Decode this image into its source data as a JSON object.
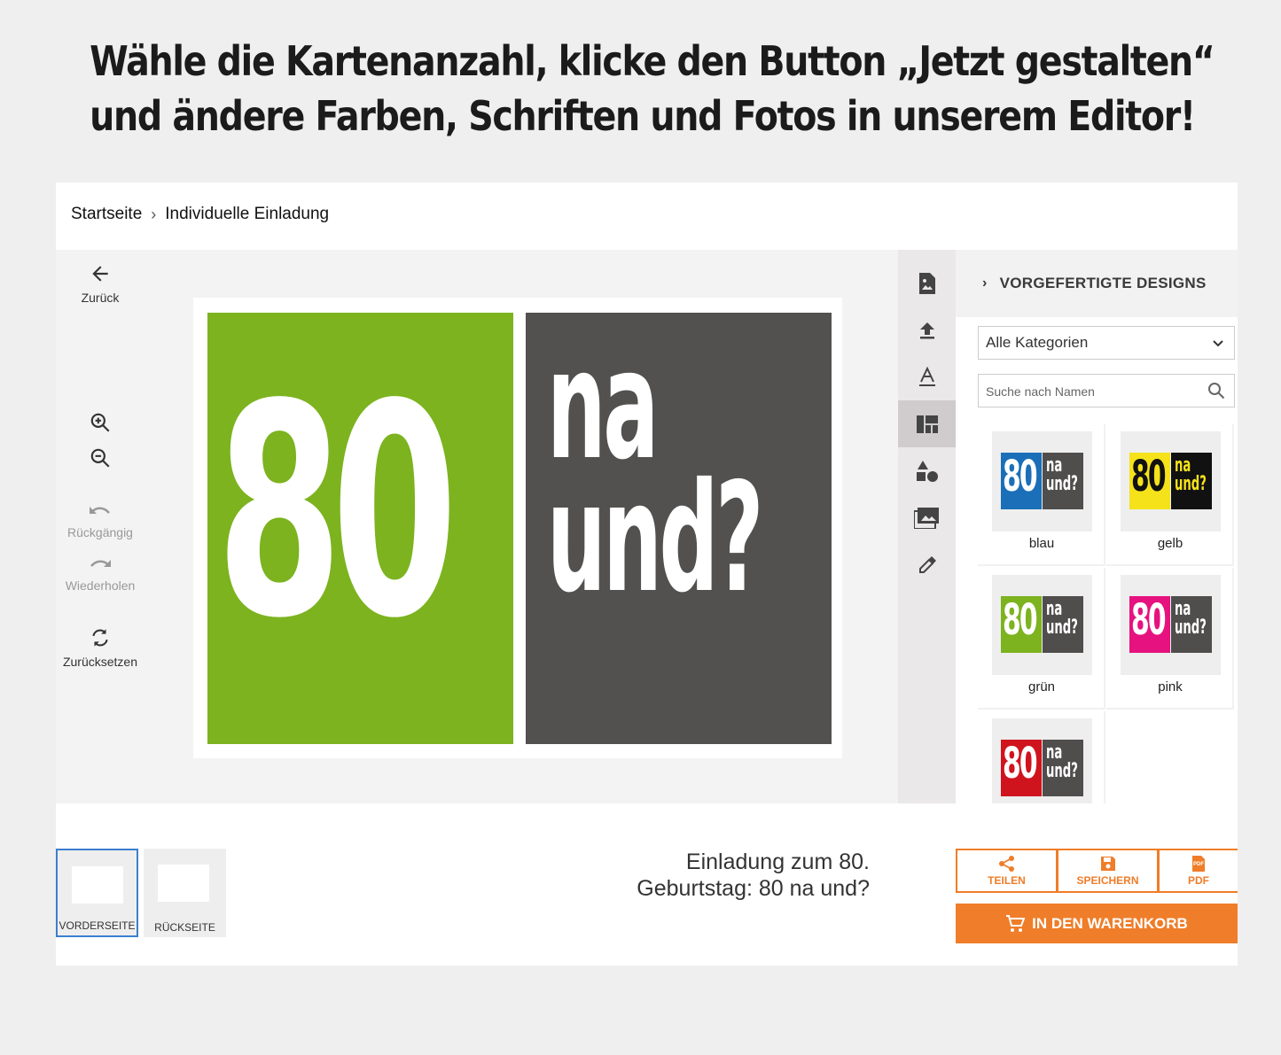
{
  "headline": {
    "line1": "Wähle die Kartenanzahl, klicke den Button „Jetzt gestalten“",
    "line2": "und ändere Farben, Schriften und Fotos in unserem Editor!"
  },
  "breadcrumb": {
    "home": "Startseite",
    "current": "Individuelle Einladung"
  },
  "toolbar": {
    "back": "Zurück",
    "undo": "Rückgängig",
    "redo": "Wiederholen",
    "reset": "Zurücksetzen"
  },
  "card": {
    "number": "80",
    "line1": "na",
    "line2": "und?",
    "left_color": "#7cb31f",
    "right_color": "#525150"
  },
  "panel": {
    "title": "VORGEFERTIGTE DESIGNS",
    "category": "Alle Kategorien",
    "search_placeholder": "Suche nach Namen",
    "designs": [
      {
        "name": "blau",
        "left": "#1a6fb8",
        "right": "#4f4e4d",
        "text": "#ffffff"
      },
      {
        "name": "gelb",
        "left": "#f5e21a",
        "right": "#111111",
        "text": "#111111",
        "text_right": "#f5e21a"
      },
      {
        "name": "grün",
        "left": "#7cb31f",
        "right": "#4f4e4d",
        "text": "#ffffff"
      },
      {
        "name": "pink",
        "left": "#e6127f",
        "right": "#4f4e4d",
        "text": "#ffffff"
      },
      {
        "name": "",
        "left": "#d0141e",
        "right": "#4f4e4d",
        "text": "#ffffff"
      }
    ],
    "thumb_number": "80",
    "thumb_na": "na",
    "thumb_und": "und?"
  },
  "pages": {
    "front": "VORDERSEITE",
    "back": "RÜCKSEITE"
  },
  "product": {
    "line1": "Einladung zum 80.",
    "line2": "Geburtstag: 80 na und?"
  },
  "actions": {
    "share": "TEILEN",
    "save": "SPEICHERN",
    "pdf": "PDF",
    "pdf_icon": "PDF",
    "cart": "IN DEN WARENKORB"
  },
  "colors": {
    "accent": "#ef7d29",
    "active_page": "#3b7fd0"
  }
}
